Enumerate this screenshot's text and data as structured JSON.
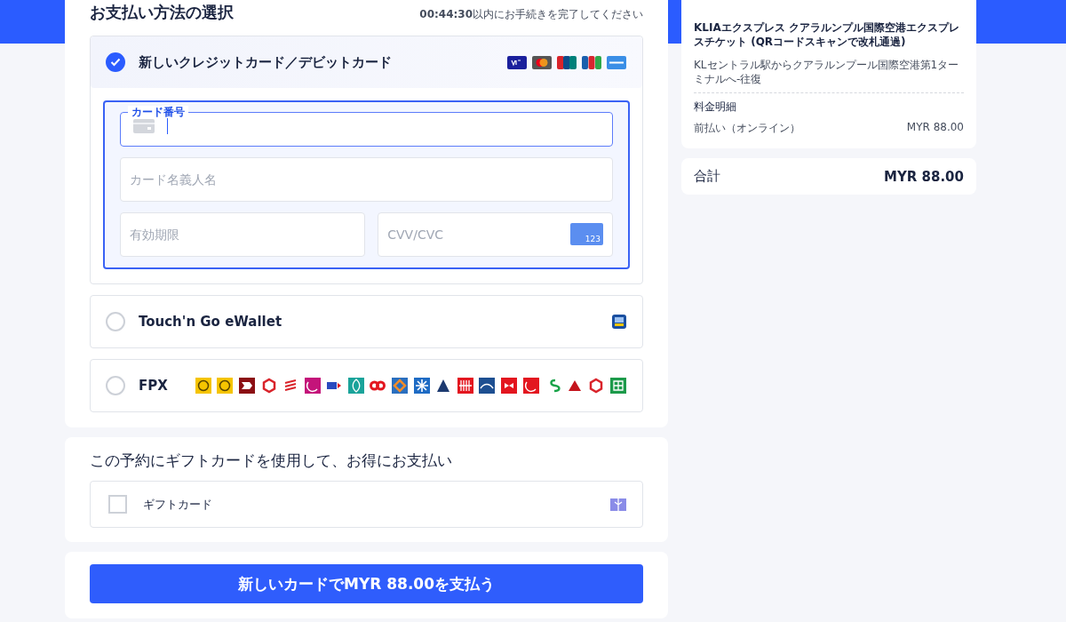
{
  "heading": "お支払い方法の選択",
  "timer": "**00:44:30**以内にお手続きを完了してください",
  "methods": [
    {
      "kind": "card",
      "label": "新しいクレジットカード／デビットカード",
      "selected": true,
      "card_number": {
        "label": "カード番号"
      },
      "holder": {
        "placeholder": "カード名義人名"
      },
      "expiry": {
        "placeholder": "有効期限"
      },
      "cvv": {
        "placeholder": "CVV/CVC",
        "badge": "123"
      }
    },
    {
      "kind": "wallet",
      "label": "Touch'n Go eWallet",
      "selected": false
    },
    {
      "kind": "fpx",
      "label": "FPX",
      "selected": false
    }
  ],
  "gift": {
    "title": "この予約にギフトカードを使用して、お得にお支払い",
    "label": "ギフトカード",
    "checked": false
  },
  "pay_button": "新しいカードでMYR 88.00を支払う",
  "summary": {
    "product": "KLIAエクスプレス クアラルンプル国際空港エクスプレスチケット (QRコードスキャンで改札通過)",
    "route": "KLセントラル駅からクアラルンプール国際空港第1ターミナルへ-往復",
    "breakdown_title": "料金明細",
    "lines": [
      {
        "label": "前払い（オンライン）",
        "amount": "MYR 88.00"
      }
    ],
    "total_label": "合計",
    "total": "MYR 88.00"
  }
}
